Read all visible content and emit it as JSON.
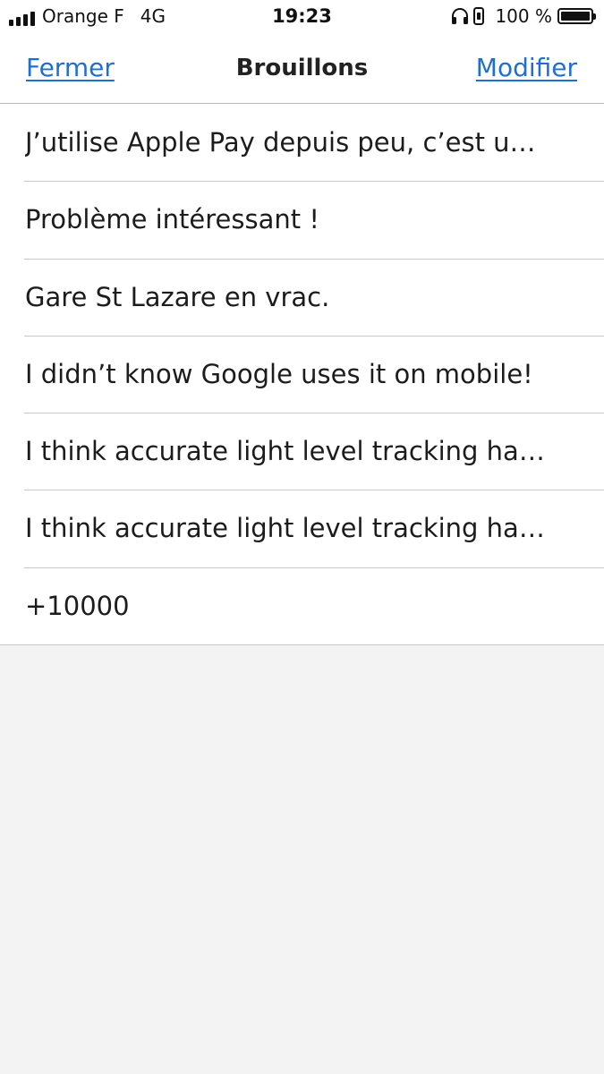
{
  "status_bar": {
    "carrier": "Orange F",
    "network": "4G",
    "time": "19:23",
    "battery_text": "100 %",
    "battery_level": 1.0,
    "signal_bars": 4,
    "icons": [
      "signal-icon",
      "headphones-icon",
      "orientation-lock-icon",
      "battery-icon"
    ]
  },
  "nav": {
    "close_label": "Fermer",
    "title": "Brouillons",
    "edit_label": "Modifier",
    "accent_color": "#1f6fd1"
  },
  "drafts": [
    {
      "text": "J’utilise Apple Pay depuis peu, c’est u…"
    },
    {
      "text": "Problème intéressant !"
    },
    {
      "text": "Gare St Lazare en vrac."
    },
    {
      "text": "I didn’t know Google uses it on mobile!"
    },
    {
      "text": "I think accurate light level tracking ha…"
    },
    {
      "text": "I think accurate light level tracking ha…"
    },
    {
      "text": "+10000"
    }
  ]
}
